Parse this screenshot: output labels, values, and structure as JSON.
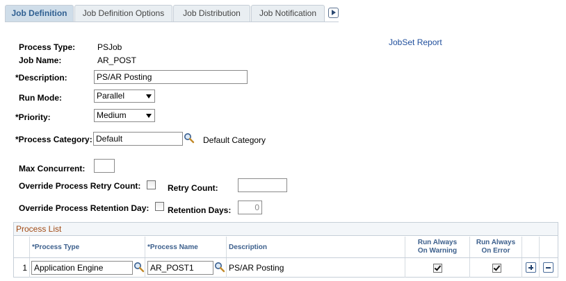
{
  "tabs": [
    {
      "label": "Job Definition",
      "active": true
    },
    {
      "label": "Job Definition Options",
      "active": false
    },
    {
      "label": "Job Distribution",
      "active": false
    },
    {
      "label": "Job Notification",
      "active": false
    }
  ],
  "header": {
    "process_type_label": "Process Type:",
    "process_type_value": "PSJob",
    "job_name_label": "Job Name:",
    "job_name_value": "AR_POST",
    "jobset_report_link": "JobSet Report"
  },
  "form": {
    "description_label": "*Description:",
    "description_value": "PS/AR Posting",
    "run_mode_label": "Run Mode:",
    "run_mode_value": "Parallel",
    "priority_label": "*Priority:",
    "priority_value": "Medium",
    "process_category_label": "*Process Category:",
    "process_category_value": "Default",
    "process_category_desc": "Default Category",
    "max_concurrent_label": "Max Concurrent:",
    "max_concurrent_value": "",
    "override_retry_label": "Override Process Retry Count:",
    "override_retry_checked": false,
    "retry_count_label": "Retry Count:",
    "retry_count_value": "",
    "override_retention_label": "Override Process Retention Day:",
    "override_retention_checked": false,
    "retention_days_label": "Retention Days:",
    "retention_days_value": "0"
  },
  "process_list": {
    "title": "Process List",
    "columns": {
      "process_type": "*Process Type",
      "process_name": "*Process Name",
      "description": "Description",
      "run_on_warning": "Run Always On Warning",
      "run_on_error": "Run Always On Error"
    },
    "rows": [
      {
        "num": "1",
        "process_type": "Application Engine",
        "process_name": "AR_POST1",
        "description": "PS/AR Posting",
        "run_on_warning": true,
        "run_on_error": true
      }
    ]
  },
  "icons": {
    "lookup": "magnifier-icon",
    "tab_scroll": "arrow-right-icon",
    "add_row": "plus-icon",
    "delete_row": "minus-icon"
  },
  "colors": {
    "tab_active_text": "#2f5f91",
    "link": "#1f4e9c",
    "grid_title": "#a14a14",
    "grid_header": "#3c5f8c"
  }
}
